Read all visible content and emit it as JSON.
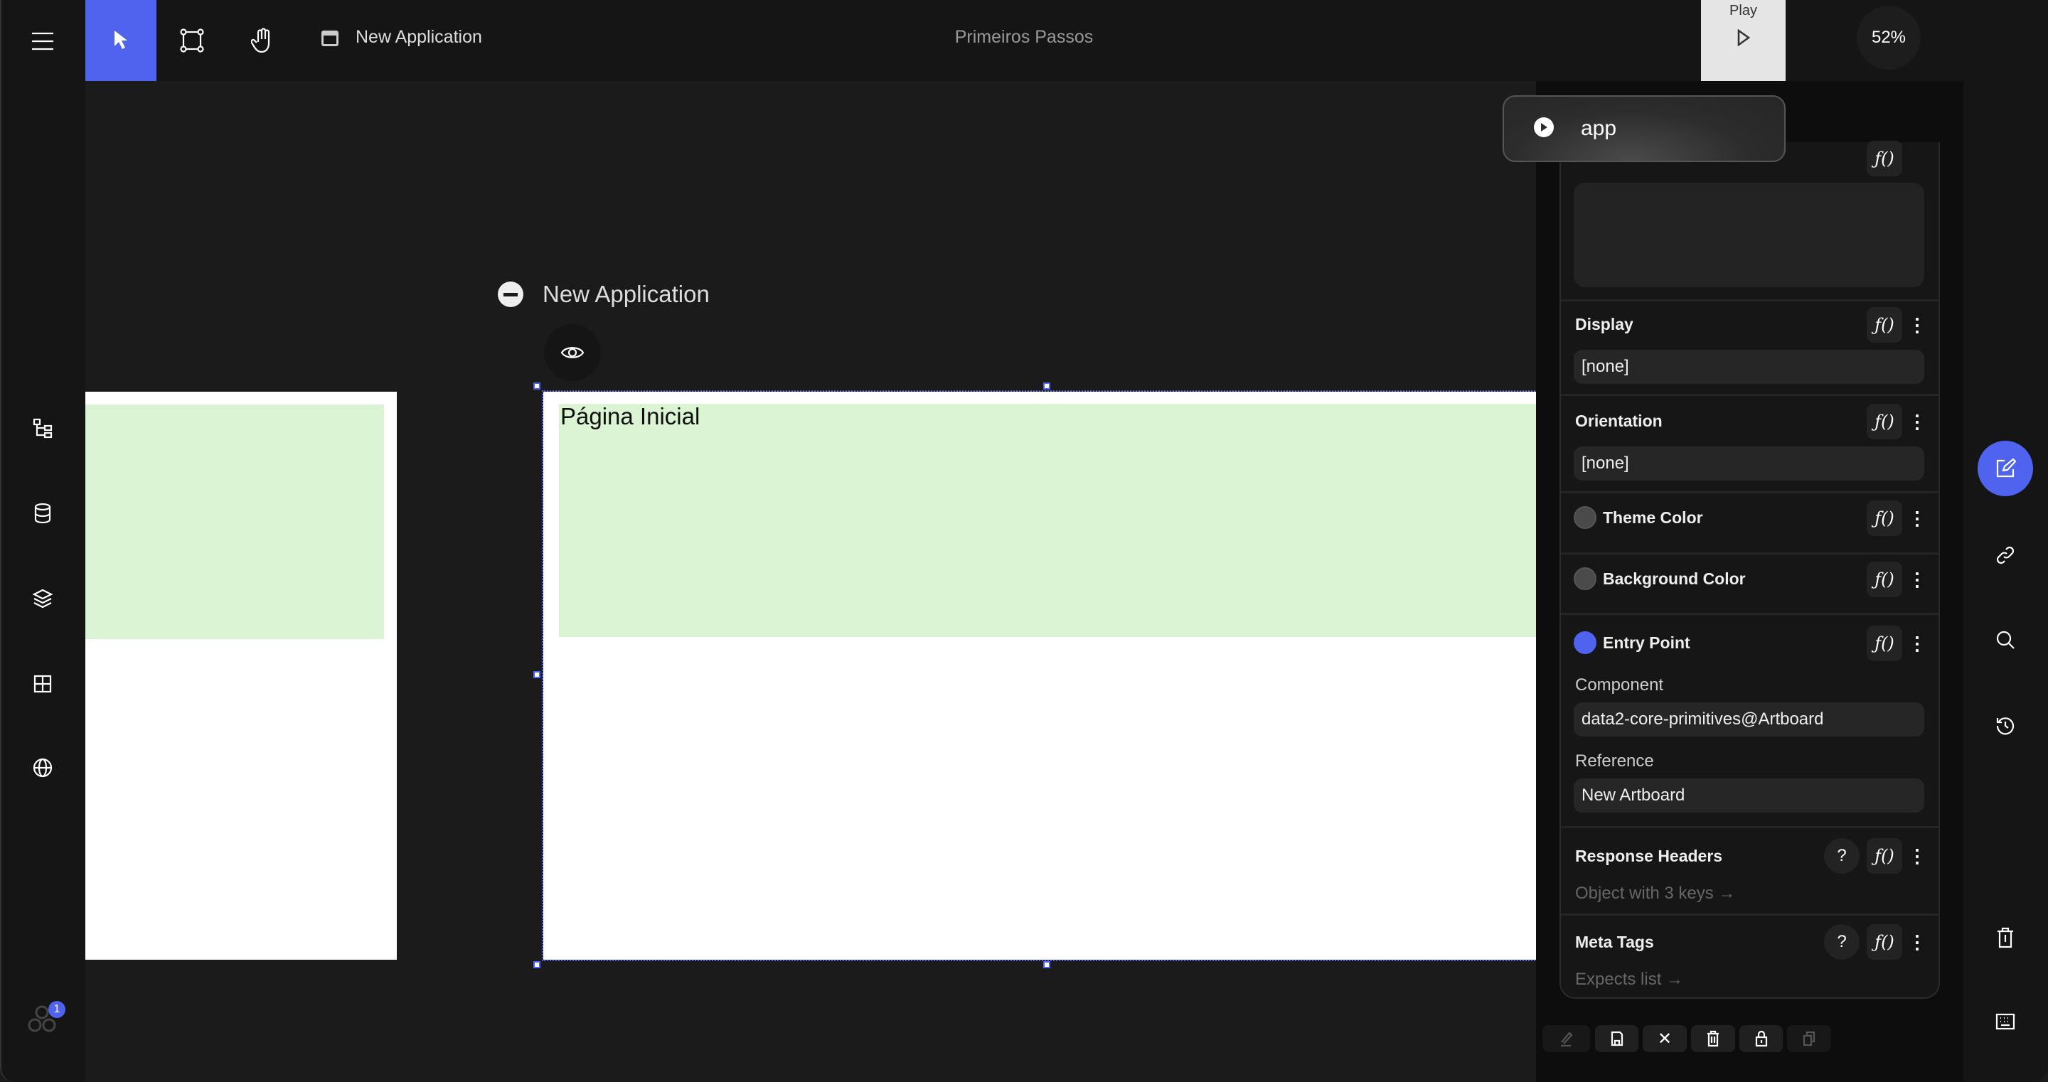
{
  "topbar": {
    "doc_title": "New Application",
    "project": "Primeiros Passos",
    "play_label": "Play",
    "zoom": "52%"
  },
  "colors": {
    "accent": "#4f63ef",
    "artboard_header": "#daf4d4",
    "theme_color": "#4a4a4a",
    "background_color": "#4a4a4a",
    "entry_point": "#4f63ef"
  },
  "popup": {
    "label": "app"
  },
  "canvas": {
    "app_title": "New Application",
    "page_title": "Página Inicial"
  },
  "panel": {
    "display": {
      "label": "Display",
      "value": "[none]"
    },
    "orientation": {
      "label": "Orientation",
      "value": "[none]"
    },
    "theme_color": {
      "label": "Theme Color"
    },
    "background_color": {
      "label": "Background Color"
    },
    "entry_point": {
      "label": "Entry Point",
      "component_label": "Component",
      "component_value": "data2-core-primitives@Artboard",
      "reference_label": "Reference",
      "reference_value": "New Artboard"
    },
    "response_headers": {
      "label": "Response Headers",
      "value": "Object with 3 keys →"
    },
    "meta_tags": {
      "label": "Meta Tags",
      "value": "Expects list →"
    },
    "fx": "ƒ()",
    "help": "?",
    "more": "⋮"
  },
  "notifications": {
    "count": "1"
  }
}
